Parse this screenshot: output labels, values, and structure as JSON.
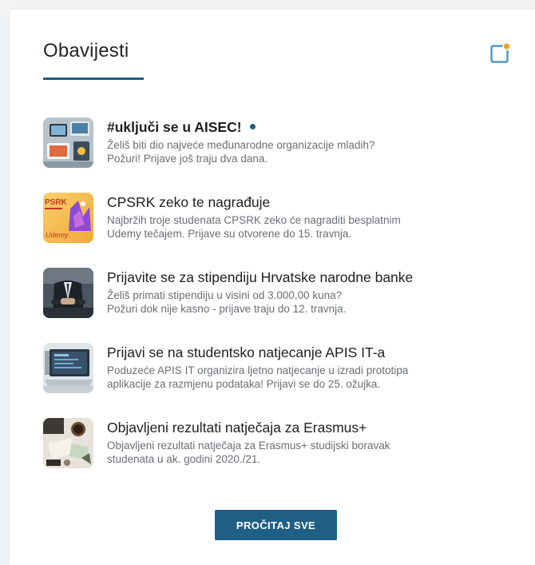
{
  "widget": {
    "title": "Obavijesti",
    "notification_icon": "notification-badge-icon",
    "accent_color": "#1e5d84",
    "badge_color": "#f0a020"
  },
  "items": [
    {
      "title": "#uključi se u AISEC!",
      "unread": true,
      "desc": "Želiš biti dio najveće međunarodne organizacije mladih?\nPožuri! Prijave još traju dva dana.",
      "thumb": "laptop-desk-photo"
    },
    {
      "title": "CPSRK zeko te nagrađuje",
      "unread": false,
      "desc": "Najbržih troje studenata CPSRK zeko će nagraditi besplatnim\nUdemy tečajem. Prijave su otvorene do 15. travnja.",
      "thumb": "cpsrk-udemy-graphic",
      "thumb_text_top": "PSRK",
      "thumb_text_bottom": "Udemy"
    },
    {
      "title": "Prijavite se za stipendiju Hrvatske narodne banke",
      "unread": false,
      "desc": "Želiš primati stipendiju u visini od 3.000,00 kuna?\nPožuri dok nije kasno - prijave traju do 12. travnja.",
      "thumb": "businessman-suit-photo"
    },
    {
      "title": "Prijavi se na studentsko natjecanje APIS IT-a",
      "unread": false,
      "desc": "Poduzeće APIS IT organizira ljetno natjecanje u izradi prototipa\naplikacije za razmjenu podataka! Prijavi se do 25. ožujka.",
      "thumb": "laptop-screen-photo"
    },
    {
      "title": "Objavljeni rezultati natječaja za Erasmus+",
      "unread": false,
      "desc": "Objavljeni rezultati natječaja za Erasmus+ studijski boravak\nstudenata u ak. godini 2020./21.",
      "thumb": "travel-desk-photo"
    }
  ],
  "footer": {
    "read_all_label": "PROČITAJ SVE"
  }
}
